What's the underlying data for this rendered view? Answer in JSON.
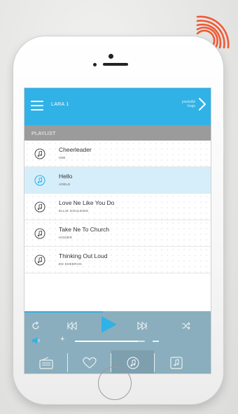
{
  "header": {
    "playlist_name": "LARA 1",
    "next_label": "predošlé hraje"
  },
  "section": {
    "label": "PLAYLIST"
  },
  "playlist": {
    "tracks": [
      {
        "title": "Cheerleader",
        "artist": "OMI",
        "active": false
      },
      {
        "title": "Hello",
        "artist": "ADELE",
        "active": true
      },
      {
        "title": "Love Ne Like You Do",
        "artist": "ELLIE GOULDING",
        "active": false
      },
      {
        "title": "Take Ne To Church",
        "artist": "HOZIER",
        "active": false
      },
      {
        "title": "Thinking Out Loud",
        "artist": "ED SHEERAN",
        "active": false
      }
    ]
  },
  "player": {
    "progress_fraction": 0.42,
    "volume_fraction": 0.9,
    "controls": {
      "repeat": "repeat-icon",
      "previous": "previous-icon",
      "play": "play-icon",
      "next": "next-icon",
      "shuffle": "shuffle-icon",
      "volume": "volume-icon"
    },
    "tabs": [
      {
        "icon": "radio-icon",
        "active": false
      },
      {
        "icon": "heart-icon",
        "active": false
      },
      {
        "icon": "music-note-icon",
        "active": true
      },
      {
        "icon": "music-library-icon",
        "active": false
      }
    ]
  },
  "colors": {
    "accent": "#31b2e6",
    "section_bar": "#9b9b9b",
    "player_bar": "#8aaebd",
    "active_row": "#d6eefa",
    "signal": "#f05a35"
  }
}
